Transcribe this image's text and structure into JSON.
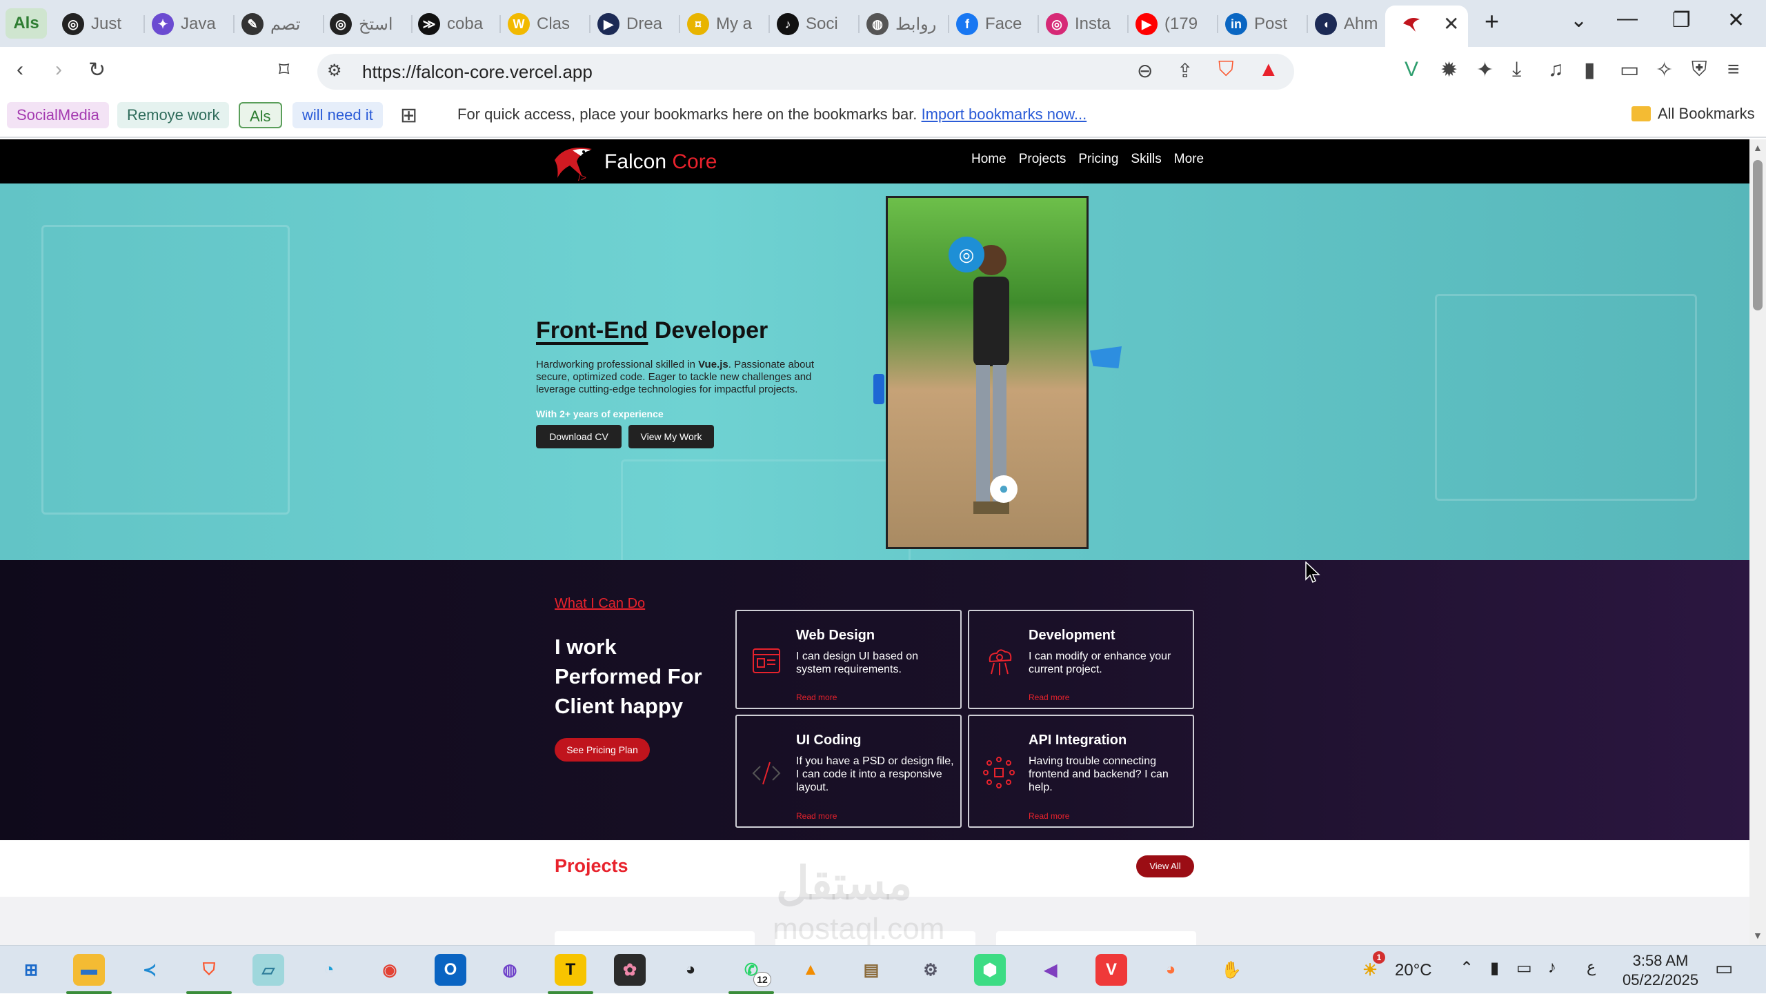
{
  "browser": {
    "tabs": [
      {
        "label": "Als",
        "icon": "als-icon"
      },
      {
        "label": "Just",
        "icon": "openai-icon"
      },
      {
        "label": "Java",
        "icon": "ai-star-icon"
      },
      {
        "label": "تصم",
        "icon": "pen-icon"
      },
      {
        "label": "استخ",
        "icon": "openai-icon"
      },
      {
        "label": "coba",
        "icon": "terminal-icon"
      },
      {
        "label": "Clas",
        "icon": "w-icon"
      },
      {
        "label": "Drea",
        "icon": "play-icon"
      },
      {
        "label": "My a",
        "icon": "coin-icon"
      },
      {
        "label": "Soci",
        "icon": "tiktok-icon"
      },
      {
        "label": "روابط",
        "icon": "globe-icon"
      },
      {
        "label": "Face",
        "icon": "facebook-icon"
      },
      {
        "label": "Insta",
        "icon": "instagram-icon"
      },
      {
        "label": "(179",
        "icon": "youtube-icon"
      },
      {
        "label": "Post",
        "icon": "linkedin-icon"
      },
      {
        "label": "Ahm",
        "icon": "brand-icon"
      }
    ],
    "url": "https://falcon-core.vercel.app",
    "bookmarks": [
      {
        "label": "SocialMedia",
        "color": "#f3e3f5",
        "text": "#a43ab0"
      },
      {
        "label": "Remoye work",
        "color": "#e5f2ef",
        "text": "#2e6b5a"
      },
      {
        "label": "Als",
        "color": "#eaf4ea",
        "text": "#2e7d32"
      },
      {
        "label": "will need it",
        "color": "#e6eefa",
        "text": "#2a5bd7"
      }
    ],
    "bookmark_hint": "For quick access, place your bookmarks here on the bookmarks bar.",
    "bookmark_import": "Import bookmarks now...",
    "all_bookmarks": "All Bookmarks"
  },
  "site": {
    "logo_text": "Falcon",
    "logo_accent": "Core",
    "nav": [
      "Home",
      "Projects",
      "Pricing",
      "Skills",
      "More"
    ],
    "hero": {
      "title_underlined": "Front-End",
      "title_rest": "Developer",
      "desc_before": "Hardworking professional skilled in ",
      "desc_bold": "Vue.js",
      "desc_after": ". Passionate about secure, optimized code. Eager to tackle new challenges and leverage cutting-edge technologies for impactful projects.",
      "experience": "With 2+ years of experience",
      "btn_cv": "Download CV",
      "btn_work": "View My Work"
    },
    "services": {
      "kicker": "What I Can Do",
      "heading": "I work Performed For Client happy",
      "cta": "See Pricing Plan",
      "cards": [
        {
          "title": "Web Design",
          "text": "I can design UI based on system requirements.",
          "more": "Read more",
          "icon": "web-design-icon"
        },
        {
          "title": "Development",
          "text": "I can modify or enhance your current project.",
          "more": "Read more",
          "icon": "cloud-dev-icon"
        },
        {
          "title": "UI Coding",
          "text": "If you have a PSD or design file, I can code it into a responsive layout.",
          "more": "Read more",
          "icon": "code-icon"
        },
        {
          "title": "API Integration",
          "text": "Having trouble connecting frontend and backend? I can help.",
          "more": "Read more",
          "icon": "api-icon"
        }
      ]
    },
    "projects": {
      "title": "Projects",
      "view_all": "View All"
    },
    "watermark": "مستقل",
    "watermark_sub": "mostaql.com"
  },
  "taskbar": {
    "temperature": "20°C",
    "time": "3:58 AM",
    "date": "05/22/2025",
    "whatsapp_badge": "12",
    "weather_badge": "1",
    "lang": "ع"
  },
  "colors": {
    "accent": "#e8222c",
    "hero_bg": "#66c9ca",
    "services_bg": "#150d22"
  }
}
